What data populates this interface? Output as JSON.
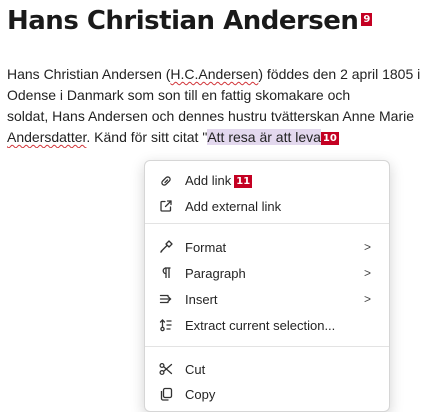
{
  "document": {
    "heading": "Hans Christian Andersen",
    "heading_badge": "9",
    "paragraph": {
      "line1_a": "Hans Christian Andersen (",
      "line1_b": "H.C.Andersen",
      "line1_c": ") föddes den 2 april 1805 i",
      "line2": "Odense i Danmark som son till en fattig skomakare och",
      "line3": "soldat, Hans Andersen och dennes hustru tvätterskan Anne Marie",
      "line4_a": "Andersdatter",
      "line4_b": ". Känd för sitt citat \"",
      "line4_sel": "Att resa är att leva",
      "selection_badge": "10"
    }
  },
  "context_menu": {
    "add_link": "Add link",
    "add_link_badge": "11",
    "add_external_link": "Add external link",
    "format": "Format",
    "paragraph": "Paragraph",
    "insert": "Insert",
    "extract": "Extract current selection...",
    "cut": "Cut",
    "copy": "Copy",
    "submenu_chevron": ">"
  },
  "colors": {
    "badge": "#c40022",
    "selection": "#e3d8ee",
    "spellcheck": "#d13438"
  }
}
